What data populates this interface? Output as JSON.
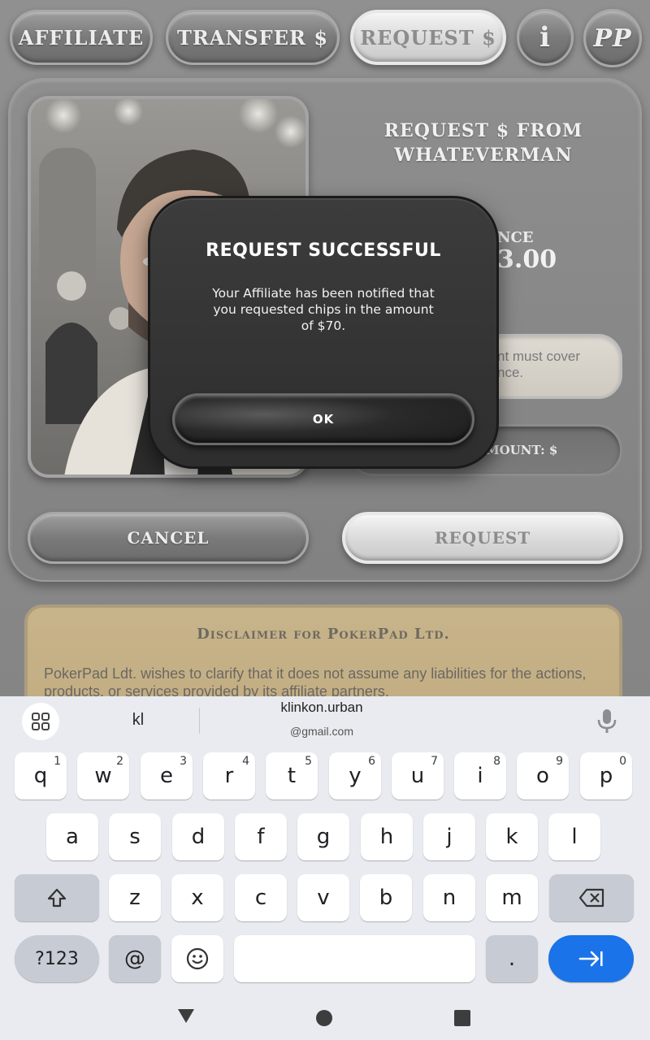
{
  "tabs": {
    "affiliate": "AFFILIATE",
    "transfer": "TRANSFER $",
    "request": "REQUEST $",
    "info": "i",
    "logo": "PP"
  },
  "request_panel": {
    "title_line1": "REQUEST $ FROM",
    "title_line2": "WHATEVERMAN",
    "balance_label": "NCE",
    "balance_value": "3.00",
    "note_line1": "nt must cover",
    "note_line2": "nce.",
    "amount_label": "MOUNT: $",
    "cancel_label": "CANCEL",
    "request_label": "REQUEST"
  },
  "disclaimer": {
    "title": "Disclaimer for PokerPad Ltd.",
    "body": "PokerPad Ldt. wishes to clarify that it does not assume any liabilities for the actions, products, or services provided by its affiliate partners."
  },
  "modal": {
    "title": "REQUEST SUCCESSFUL",
    "message": "Your Affiliate has been notified that you requested chips in the amount of $70.",
    "ok_label": "OK"
  },
  "keyboard": {
    "suggestions": {
      "first": "kl",
      "email_user": "klinkon.urban",
      "email_domain": "@gmail.com"
    },
    "row1": [
      {
        "k": "q",
        "h": "1"
      },
      {
        "k": "w",
        "h": "2"
      },
      {
        "k": "e",
        "h": "3"
      },
      {
        "k": "r",
        "h": "4"
      },
      {
        "k": "t",
        "h": "5"
      },
      {
        "k": "y",
        "h": "6"
      },
      {
        "k": "u",
        "h": "7"
      },
      {
        "k": "i",
        "h": "8"
      },
      {
        "k": "o",
        "h": "9"
      },
      {
        "k": "p",
        "h": "0"
      }
    ],
    "row2": [
      "a",
      "s",
      "d",
      "f",
      "g",
      "h",
      "j",
      "k",
      "l"
    ],
    "row3": [
      "z",
      "x",
      "c",
      "v",
      "b",
      "n",
      "m"
    ],
    "symbols_label": "?123",
    "at_label": "@",
    "period_label": "."
  },
  "colors": {
    "accent_blue": "#1a73e8",
    "modal_bg": "#333333",
    "disclaimer_bg": "#c8b48a"
  }
}
